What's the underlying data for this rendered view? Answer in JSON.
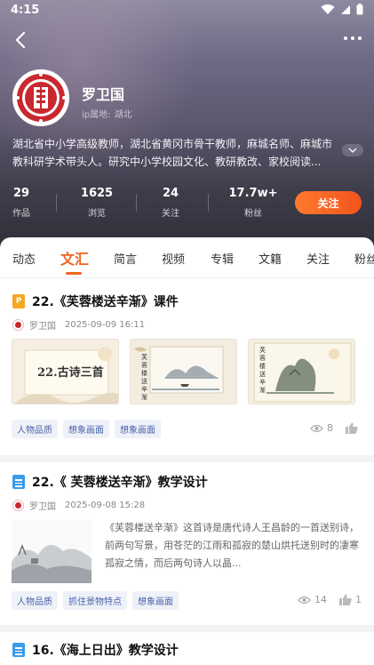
{
  "status_bar": {
    "time": "4:15"
  },
  "profile": {
    "name": "罗卫国",
    "ip_label": "ip属地:",
    "ip_location": "湖北",
    "bio": "湖北省中小学高级教师，湖北省黄冈市骨干教师，麻城名师、麻城市教科研学术带头人。研究中小学校园文化、教研教改、家校阅读..."
  },
  "stats": [
    {
      "value": "29",
      "label": "作品"
    },
    {
      "value": "1625",
      "label": "浏览"
    },
    {
      "value": "24",
      "label": "关注"
    },
    {
      "value": "17.7w+",
      "label": "粉丝"
    }
  ],
  "follow_label": "关注",
  "tabs": [
    "动态",
    "文汇",
    "简言",
    "视频",
    "专辑",
    "文籍",
    "关注",
    "粉丝"
  ],
  "active_tab": "文汇",
  "cards": [
    {
      "icon": "ppt-file-icon",
      "title": "22.《芙蓉楼送辛渐》课件",
      "author": "罗卫国",
      "date": "2025-09-09 16:11",
      "thumb_texts": [
        "22.古诗三首",
        "芙蓉楼送辛渐",
        "芙蓉楼送辛渐"
      ],
      "tags": [
        "人物品质",
        "想象画面",
        "想象画面"
      ],
      "views": "8",
      "likes": ""
    },
    {
      "icon": "doc-file-icon",
      "title": "22.《 芙蓉楼送辛渐》教学设计",
      "author": "罗卫国",
      "date": "2025-09-08 15:28",
      "excerpt": "《芙蓉楼送辛渐》这首诗是唐代诗人王昌龄的一首送别诗，前两句写景，用苍茫的江雨和孤寂的楚山烘托送别时的凄寒孤寂之情，而后两句诗人以晶...",
      "tags": [
        "人物品质",
        "抓住景物特点",
        "想象画面"
      ],
      "views": "14",
      "likes": "1"
    },
    {
      "icon": "doc-file-icon",
      "title": "16.《海上日出》教学设计"
    }
  ],
  "colors": {
    "accent": "#f0651f",
    "tag_text": "#4a64a8",
    "tag_bg": "#eef1f8"
  }
}
